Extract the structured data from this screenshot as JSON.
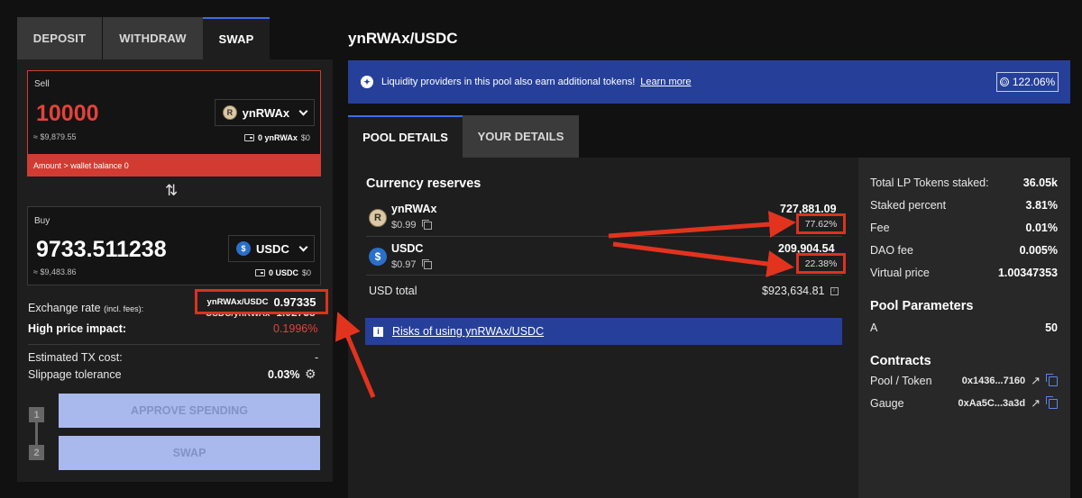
{
  "tabs_left": [
    "DEPOSIT",
    "WITHDRAW",
    "SWAP"
  ],
  "sell": {
    "label": "Sell",
    "amount": "10000",
    "usd": "≈ $9,879.55",
    "token": "ynRWAx",
    "wallet_amount": "0 ynRWAx",
    "wallet_usd": "$0",
    "error": "Amount > wallet balance 0"
  },
  "buy": {
    "label": "Buy",
    "amount": "9733.511238",
    "usd": "≈ $9,483.86",
    "token": "USDC",
    "wallet_amount": "0 USDC",
    "wallet_usd": "$0"
  },
  "exchange": {
    "label": "Exchange rate",
    "label_small": "(incl. fees):",
    "pair1": "ynRWAx/USDC",
    "rate1": "0.97335",
    "pair2": "USDC/ynRWAx",
    "rate2": "1.02738",
    "impact_label": "High price impact:",
    "impact_value": "0.1996%",
    "tx_label": "Estimated TX cost:",
    "tx_value": "-",
    "slippage_label": "Slippage tolerance",
    "slippage_value": "0.03%"
  },
  "buttons": {
    "approve": "APPROVE SPENDING",
    "swap": "SWAP",
    "step1": "1",
    "step2": "2"
  },
  "pool": {
    "title": "ynRWAx/USDC",
    "banner_text": "Liquidity providers in this pool also earn additional tokens!",
    "banner_link": "Learn more",
    "apy": "122.06%",
    "tabs": [
      "POOL DETAILS",
      "YOUR DETAILS"
    ],
    "reserves_title": "Currency reserves",
    "reserves": [
      {
        "token": "ynRWAx",
        "price": "$0.99",
        "amount": "727,881.09",
        "percent": "77.62%"
      },
      {
        "token": "USDC",
        "price": "$0.97",
        "amount": "209,904.54",
        "percent": "22.38%"
      }
    ],
    "usd_total_label": "USD total",
    "usd_total": "$923,634.81",
    "risk_link": "Risks of using ynRWAx/USDC"
  },
  "stats": [
    {
      "label": "Total LP Tokens staked:",
      "value": "36.05k"
    },
    {
      "label": "Staked percent",
      "value": "3.81%"
    },
    {
      "label": "Fee",
      "value": "0.01%"
    },
    {
      "label": "DAO fee",
      "value": "0.005%"
    },
    {
      "label": "Virtual price",
      "value": "1.00347353"
    }
  ],
  "params": {
    "title": "Pool Parameters",
    "a_label": "A",
    "a_value": "50"
  },
  "contracts": {
    "title": "Contracts",
    "items": [
      {
        "label": "Pool / Token",
        "address": "0x1436...7160"
      },
      {
        "label": "Gauge",
        "address": "0xAa5C...3a3d"
      }
    ]
  },
  "colors": {
    "accent_blue": "#26409a",
    "error_red": "#d23b32",
    "highlight_red": "#d9331f",
    "button_blue": "#a9b9ee"
  }
}
